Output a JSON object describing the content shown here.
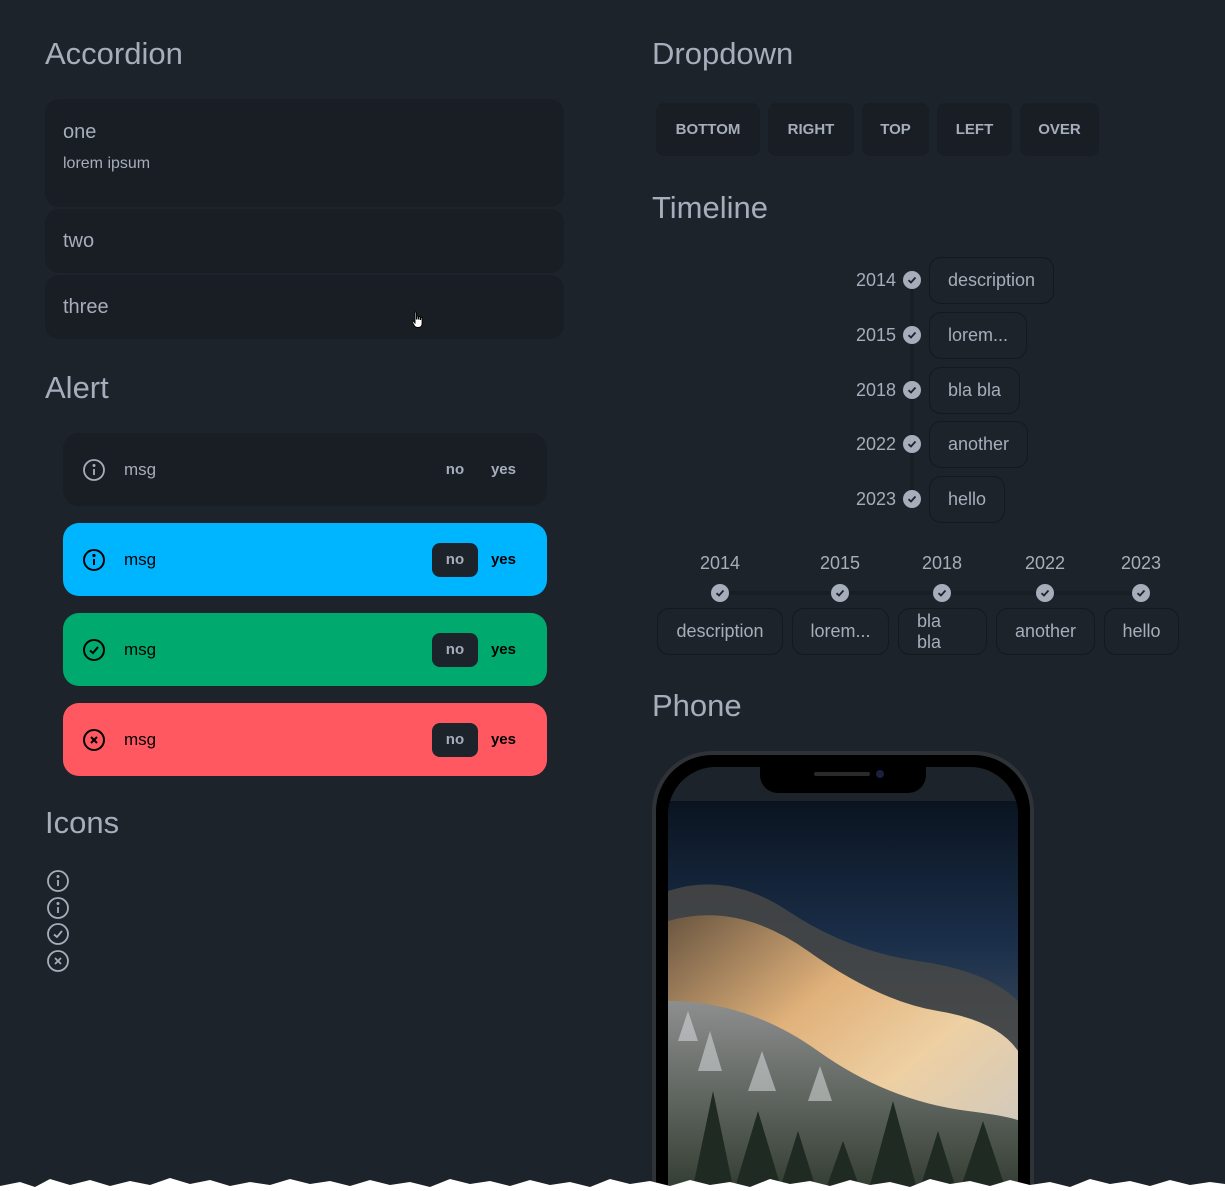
{
  "accordion": {
    "title": "Accordion",
    "items": [
      {
        "label": "one",
        "body": "lorem ipsum"
      },
      {
        "label": "two"
      },
      {
        "label": "three"
      }
    ]
  },
  "alert": {
    "title": "Alert",
    "items": [
      {
        "variant": "default",
        "icon": "info-icon",
        "message": "msg",
        "no": "no",
        "yes": "yes"
      },
      {
        "variant": "info",
        "icon": "info-icon",
        "message": "msg",
        "no": "no",
        "yes": "yes"
      },
      {
        "variant": "success",
        "icon": "check-circle-icon",
        "message": "msg",
        "no": "no",
        "yes": "yes"
      },
      {
        "variant": "error",
        "icon": "x-circle-icon",
        "message": "msg",
        "no": "no",
        "yes": "yes"
      }
    ]
  },
  "icons": {
    "title": "Icons",
    "items": [
      "info-icon",
      "info-icon",
      "check-circle-icon",
      "x-circle-icon"
    ]
  },
  "dropdown": {
    "title": "Dropdown",
    "buttons": [
      "BOTTOM",
      "RIGHT",
      "TOP",
      "LEFT",
      "OVER"
    ]
  },
  "timeline": {
    "title": "Timeline",
    "events": [
      {
        "year": "2014",
        "text": "description"
      },
      {
        "year": "2015",
        "text": "lorem..."
      },
      {
        "year": "2018",
        "text": "bla bla"
      },
      {
        "year": "2022",
        "text": "another"
      },
      {
        "year": "2023",
        "text": "hello"
      }
    ]
  },
  "phone": {
    "title": "Phone",
    "wallpaper": "misty-mountain-forest-sunrise"
  },
  "colors": {
    "background": "#1d232a",
    "card": "#191e24",
    "text": "#a6adbb",
    "info": "#00b5ff",
    "success": "#00a96e",
    "error": "#ff5861"
  }
}
